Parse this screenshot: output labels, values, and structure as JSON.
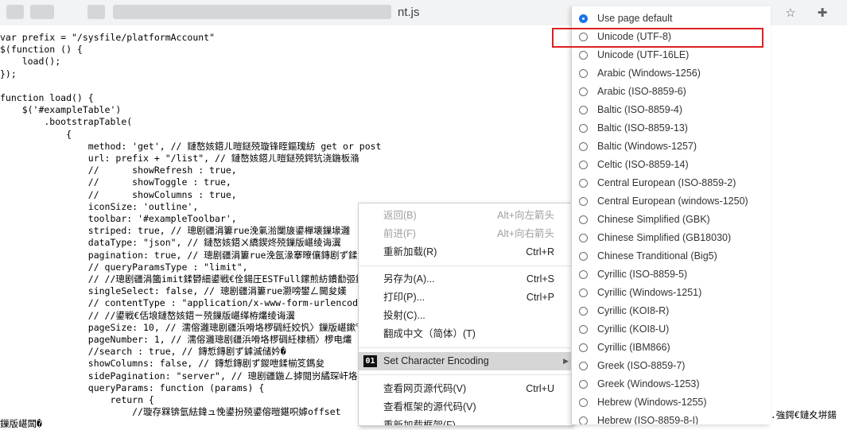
{
  "browser": {
    "tab_title_suffix": "nt.js",
    "star_icon": "star-icon",
    "extensions_icon": "puzzle-icon"
  },
  "code_lines": [
    {
      "text": "var prefix = \"/sysfile/platformAccount\"",
      "indent": 0
    },
    {
      "text": "$(function () {",
      "indent": 0
    },
    {
      "text": "    load();",
      "indent": 0
    },
    {
      "text": "});",
      "indent": 0
    },
    {
      "text": "",
      "indent": 0
    },
    {
      "text": "function load() {",
      "indent": 0
    },
    {
      "text": "    $('#exampleTable')",
      "indent": 0
    },
    {
      "text": "        .bootstrapTable(",
      "indent": 0
    },
    {
      "text": "            {",
      "indent": 0
    },
    {
      "text": "                method: 'get', // 鏈嶅姟鍣ㄦ暟鎹殑璇锋眰鏂瑰紡 get or post",
      "indent": 0
    },
    {
      "text": "                url: prefix + \"/list\", // 鏈嶅姟鍣ㄦ暟鎹殑鍔犺浇鍦板潃",
      "indent": 0
    },
    {
      "text": "                //      showRefresh : true,",
      "indent": 0
    },
    {
      "text": "                //      showToggle : true,",
      "indent": 0
    },
    {
      "text": "                //      showColumns : true,",
      "indent": 0
    },
    {
      "text": "                iconSize: 'outline',",
      "indent": 0
    },
    {
      "text": "                toolbar: '#exampleToolbar',",
      "indent": 0
    },
    {
      "text": "                striped: true, // 璁剧疆涓簍rue浼氭湁闅旇鍙樿壊鏁堟灉",
      "indent": 0
    },
    {
      "text": "                dataType: \"json\", // 鏈嶅姟鍣ㄨ繑鍥炵殑鏁版嵁绫诲瀷",
      "indent": 0
    },
    {
      "text": "                pagination: true, // 璁剧疆涓簍rue浼氬湪搴曢儴鏄剧ず鍒嗛〉鏉",
      "indent": 0
    },
    {
      "text": "                // queryParamsType : \"limit\",",
      "indent": 0
    },
    {
      "text": "                // //璁剧疆涓簂imit鍒欎細鍙戦€佺鍚圧ESTFull鏍煎紡鐨勫弬鏁",
      "indent": 0
    },
    {
      "text": "                singleSelect: false, // 璁剧疆涓簍rue灏嗙鐢ㄥ閫夋嫨",
      "indent": 0
    },
    {
      "text": "                // contentType : \"application/x-www-form-urlencoded\",",
      "indent": 0
    },
    {
      "text": "                // //鍙戦€佸埌鏈嶅姟鍣ㄧ殑鏁版嵁缂栫爜绫诲瀷",
      "indent": 0
    },
    {
      "text": "                pageSize: 10, // 濡傛灉璁剧疆浜嗗垎椤碉紝姣忛〉鏁版嵁鏉℃暟",
      "indent": 0
    },
    {
      "text": "                pageNumber: 1, // 濡傛灉璁剧疆浜嗗垎椤碉紝棣栭〉椤电爜",
      "indent": 0
    },
    {
      "text": "                //search : true, // 鏄惁鏄剧ず鎼滅储妗�",
      "indent": 0
    },
    {
      "text": "                showColumns: false, // 鏄惁鏄剧ず鍐呭鍒椾笅鎷夋",
      "indent": 0
    },
    {
      "text": "                sidePagination: \"server\", // 璁剧疆鍦ㄥ摢閲岃繘琛屽垎椤",
      "indent": 0
    },
    {
      "text": "                queryParams: function (params) {",
      "indent": 0
    },
    {
      "text": "                    return {",
      "indent": 0
    },
    {
      "text": "                        //璇存槑锛氫紶鍏ュ悗鍙扮殑鍙傛暟鍖呮嫭offset",
      "indent": 0
    },
    {
      "text": "鏁版嵁闆�",
      "indent": 0
    }
  ],
  "code_tail_right": ".  .強鍔€鏈夊垪鍚",
  "context_menu": {
    "items": [
      {
        "label": "返回(B)",
        "shortcut": "Alt+向左箭头",
        "disabled": true
      },
      {
        "label": "前进(F)",
        "shortcut": "Alt+向右箭头",
        "disabled": true
      },
      {
        "label": "重新加载(R)",
        "shortcut": "Ctrl+R",
        "disabled": false
      },
      {
        "label": "另存为(A)...",
        "shortcut": "Ctrl+S",
        "disabled": false
      },
      {
        "label": "打印(P)...",
        "shortcut": "Ctrl+P",
        "disabled": false
      },
      {
        "label": "投射(C)...",
        "shortcut": "",
        "disabled": false
      },
      {
        "label": "翻成中文（简体）(T)",
        "shortcut": "",
        "disabled": false
      },
      {
        "label": "Set Character Encoding",
        "shortcut": "",
        "disabled": false
      },
      {
        "label": "查看网页源代码(V)",
        "shortcut": "Ctrl+U",
        "disabled": false
      },
      {
        "label": "查看框架的源代码(V)",
        "shortcut": "",
        "disabled": false
      },
      {
        "label": "重新加载框架(F)",
        "shortcut": "",
        "disabled": false
      }
    ],
    "encoding_icon_text": "01"
  },
  "encoding_menu": {
    "options": [
      {
        "label": "Use page default",
        "checked": true
      },
      {
        "label": "Unicode (UTF-8)",
        "checked": false
      },
      {
        "label": "Unicode (UTF-16LE)",
        "checked": false
      },
      {
        "label": "Arabic (Windows-1256)",
        "checked": false
      },
      {
        "label": "Arabic (ISO-8859-6)",
        "checked": false
      },
      {
        "label": "Baltic (ISO-8859-4)",
        "checked": false
      },
      {
        "label": "Baltic (ISO-8859-13)",
        "checked": false
      },
      {
        "label": "Baltic (Windows-1257)",
        "checked": false
      },
      {
        "label": "Celtic (ISO-8859-14)",
        "checked": false
      },
      {
        "label": "Central European (ISO-8859-2)",
        "checked": false
      },
      {
        "label": "Central European (windows-1250)",
        "checked": false
      },
      {
        "label": "Chinese Simplified (GBK)",
        "checked": false
      },
      {
        "label": "Chinese Simplified (GB18030)",
        "checked": false
      },
      {
        "label": "Chinese Tranditional (Big5)",
        "checked": false
      },
      {
        "label": "Cyrillic (ISO-8859-5)",
        "checked": false
      },
      {
        "label": "Cyrillic (Windows-1251)",
        "checked": false
      },
      {
        "label": "Cyrillic (KOI8-R)",
        "checked": false
      },
      {
        "label": "Cyrillic (KOI8-U)",
        "checked": false
      },
      {
        "label": "Cyrillic (IBM866)",
        "checked": false
      },
      {
        "label": "Greek (ISO-8859-7)",
        "checked": false
      },
      {
        "label": "Greek (Windows-1253)",
        "checked": false
      },
      {
        "label": "Hebrew (Windows-1255)",
        "checked": false
      },
      {
        "label": "Hebrew (ISO-8859-8-I)",
        "checked": false
      }
    ],
    "highlighted": "Unicode (UTF-8)",
    "highlight_color": "#e02020",
    "radio_checked_color": "#1a73e8"
  }
}
